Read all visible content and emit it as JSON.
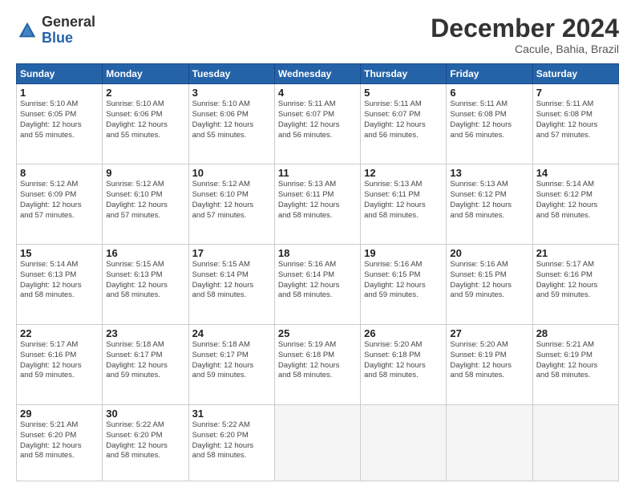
{
  "logo": {
    "general": "General",
    "blue": "Blue"
  },
  "title": "December 2024",
  "location": "Cacule, Bahia, Brazil",
  "headers": [
    "Sunday",
    "Monday",
    "Tuesday",
    "Wednesday",
    "Thursday",
    "Friday",
    "Saturday"
  ],
  "weeks": [
    [
      {
        "day": "1",
        "info": "Sunrise: 5:10 AM\nSunset: 6:05 PM\nDaylight: 12 hours\nand 55 minutes."
      },
      {
        "day": "2",
        "info": "Sunrise: 5:10 AM\nSunset: 6:06 PM\nDaylight: 12 hours\nand 55 minutes."
      },
      {
        "day": "3",
        "info": "Sunrise: 5:10 AM\nSunset: 6:06 PM\nDaylight: 12 hours\nand 55 minutes."
      },
      {
        "day": "4",
        "info": "Sunrise: 5:11 AM\nSunset: 6:07 PM\nDaylight: 12 hours\nand 56 minutes."
      },
      {
        "day": "5",
        "info": "Sunrise: 5:11 AM\nSunset: 6:07 PM\nDaylight: 12 hours\nand 56 minutes."
      },
      {
        "day": "6",
        "info": "Sunrise: 5:11 AM\nSunset: 6:08 PM\nDaylight: 12 hours\nand 56 minutes."
      },
      {
        "day": "7",
        "info": "Sunrise: 5:11 AM\nSunset: 6:08 PM\nDaylight: 12 hours\nand 57 minutes."
      }
    ],
    [
      {
        "day": "8",
        "info": "Sunrise: 5:12 AM\nSunset: 6:09 PM\nDaylight: 12 hours\nand 57 minutes."
      },
      {
        "day": "9",
        "info": "Sunrise: 5:12 AM\nSunset: 6:10 PM\nDaylight: 12 hours\nand 57 minutes."
      },
      {
        "day": "10",
        "info": "Sunrise: 5:12 AM\nSunset: 6:10 PM\nDaylight: 12 hours\nand 57 minutes."
      },
      {
        "day": "11",
        "info": "Sunrise: 5:13 AM\nSunset: 6:11 PM\nDaylight: 12 hours\nand 58 minutes."
      },
      {
        "day": "12",
        "info": "Sunrise: 5:13 AM\nSunset: 6:11 PM\nDaylight: 12 hours\nand 58 minutes."
      },
      {
        "day": "13",
        "info": "Sunrise: 5:13 AM\nSunset: 6:12 PM\nDaylight: 12 hours\nand 58 minutes."
      },
      {
        "day": "14",
        "info": "Sunrise: 5:14 AM\nSunset: 6:12 PM\nDaylight: 12 hours\nand 58 minutes."
      }
    ],
    [
      {
        "day": "15",
        "info": "Sunrise: 5:14 AM\nSunset: 6:13 PM\nDaylight: 12 hours\nand 58 minutes."
      },
      {
        "day": "16",
        "info": "Sunrise: 5:15 AM\nSunset: 6:13 PM\nDaylight: 12 hours\nand 58 minutes."
      },
      {
        "day": "17",
        "info": "Sunrise: 5:15 AM\nSunset: 6:14 PM\nDaylight: 12 hours\nand 58 minutes."
      },
      {
        "day": "18",
        "info": "Sunrise: 5:16 AM\nSunset: 6:14 PM\nDaylight: 12 hours\nand 58 minutes."
      },
      {
        "day": "19",
        "info": "Sunrise: 5:16 AM\nSunset: 6:15 PM\nDaylight: 12 hours\nand 59 minutes."
      },
      {
        "day": "20",
        "info": "Sunrise: 5:16 AM\nSunset: 6:15 PM\nDaylight: 12 hours\nand 59 minutes."
      },
      {
        "day": "21",
        "info": "Sunrise: 5:17 AM\nSunset: 6:16 PM\nDaylight: 12 hours\nand 59 minutes."
      }
    ],
    [
      {
        "day": "22",
        "info": "Sunrise: 5:17 AM\nSunset: 6:16 PM\nDaylight: 12 hours\nand 59 minutes."
      },
      {
        "day": "23",
        "info": "Sunrise: 5:18 AM\nSunset: 6:17 PM\nDaylight: 12 hours\nand 59 minutes."
      },
      {
        "day": "24",
        "info": "Sunrise: 5:18 AM\nSunset: 6:17 PM\nDaylight: 12 hours\nand 59 minutes."
      },
      {
        "day": "25",
        "info": "Sunrise: 5:19 AM\nSunset: 6:18 PM\nDaylight: 12 hours\nand 58 minutes."
      },
      {
        "day": "26",
        "info": "Sunrise: 5:20 AM\nSunset: 6:18 PM\nDaylight: 12 hours\nand 58 minutes."
      },
      {
        "day": "27",
        "info": "Sunrise: 5:20 AM\nSunset: 6:19 PM\nDaylight: 12 hours\nand 58 minutes."
      },
      {
        "day": "28",
        "info": "Sunrise: 5:21 AM\nSunset: 6:19 PM\nDaylight: 12 hours\nand 58 minutes."
      }
    ],
    [
      {
        "day": "29",
        "info": "Sunrise: 5:21 AM\nSunset: 6:20 PM\nDaylight: 12 hours\nand 58 minutes."
      },
      {
        "day": "30",
        "info": "Sunrise: 5:22 AM\nSunset: 6:20 PM\nDaylight: 12 hours\nand 58 minutes."
      },
      {
        "day": "31",
        "info": "Sunrise: 5:22 AM\nSunset: 6:20 PM\nDaylight: 12 hours\nand 58 minutes."
      },
      {
        "day": "",
        "info": ""
      },
      {
        "day": "",
        "info": ""
      },
      {
        "day": "",
        "info": ""
      },
      {
        "day": "",
        "info": ""
      }
    ]
  ]
}
